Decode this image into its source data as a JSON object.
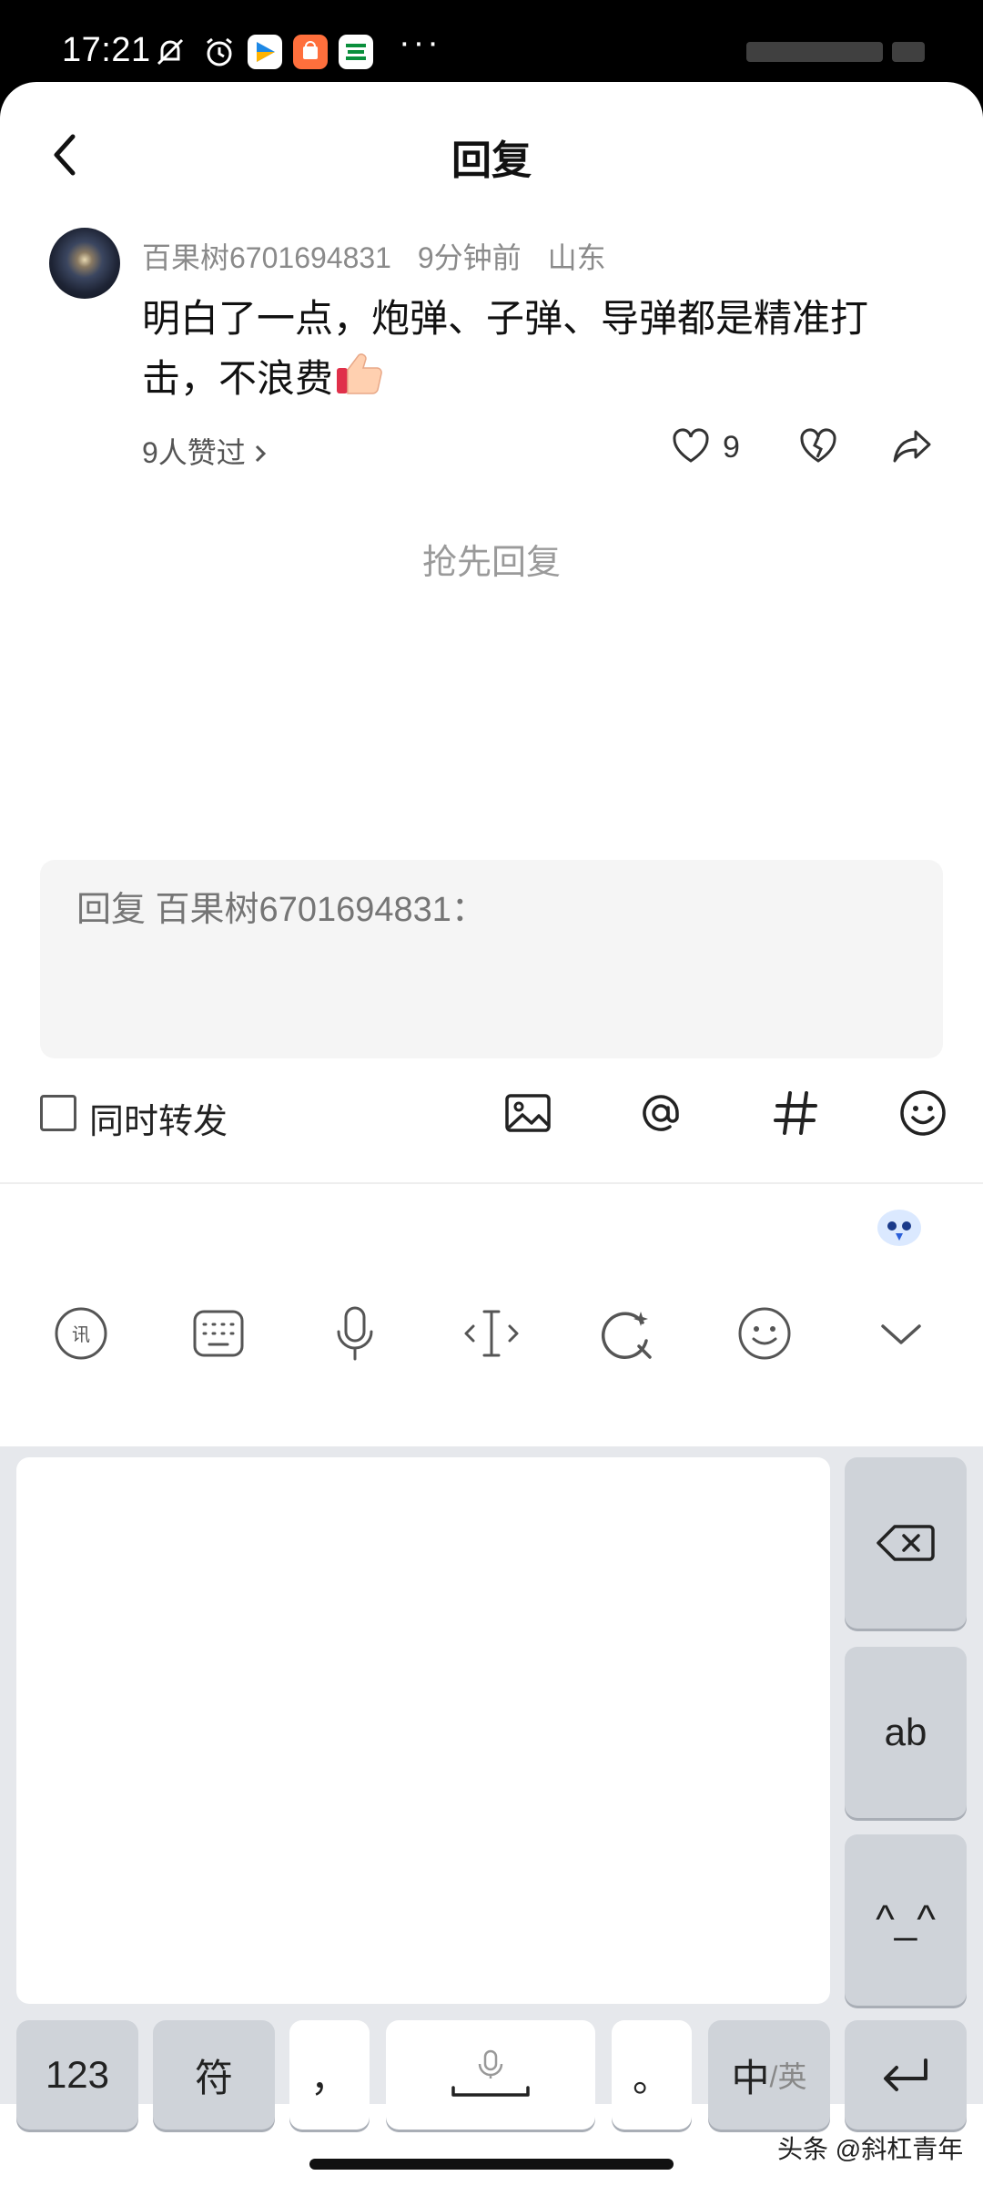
{
  "status_bar": {
    "time": "17:21",
    "more": "···"
  },
  "header": {
    "title": "回复"
  },
  "comment": {
    "username": "百果树6701694831",
    "time_ago": "9分钟前",
    "location": "山东",
    "text": "明白了一点，炮弹、子弹、导弹都是精准打击，不浪费",
    "likers_text": "9人赞过",
    "like_count": "9"
  },
  "empty_state": "抢先回复",
  "reply": {
    "placeholder": "回复 百果树6701694831："
  },
  "toolbar": {
    "repost_label": "同时转发"
  },
  "emoji_row": [
    "rose-icon",
    "laughing-face-icon",
    "rolling-laughing-icon",
    "praying-hands-icon",
    "fu-blessing-icon",
    "thumbs-up-icon",
    "tears-of-joy-icon"
  ],
  "keyboard": {
    "keys": {
      "num": "123",
      "symbol": "符",
      "comma": "，",
      "period": "。",
      "lang_main": "中",
      "lang_alt": "/英",
      "ab": "ab",
      "kaomoji": "^_^"
    }
  },
  "watermark": "头条 @斜杠青年"
}
